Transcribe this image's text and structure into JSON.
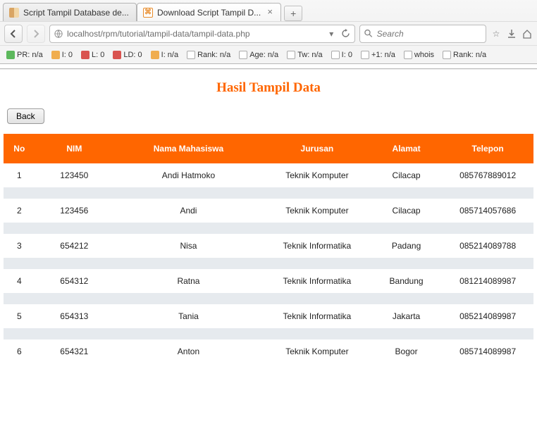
{
  "browser": {
    "tabs": [
      {
        "title": "Script Tampil Database de...",
        "active": false
      },
      {
        "title": "Download Script Tampil D...",
        "active": true
      }
    ],
    "url": "localhost/rpm/tutorial/tampil-data/tampil-data.php",
    "search_placeholder": "Search",
    "bookmarks": [
      {
        "label": "PR: n/a"
      },
      {
        "label": "I: 0"
      },
      {
        "label": "L: 0"
      },
      {
        "label": "LD: 0"
      },
      {
        "label": "I: n/a"
      },
      {
        "label": "Rank: n/a"
      },
      {
        "label": "Age: n/a"
      },
      {
        "label": "Tw: n/a"
      },
      {
        "label": "I: 0"
      },
      {
        "label": "+1: n/a"
      },
      {
        "label": "whois"
      },
      {
        "label": "Rank: n/a"
      }
    ]
  },
  "page": {
    "heading": "Hasil Tampil Data",
    "back_label": "Back",
    "columns": [
      "No",
      "NIM",
      "Nama Mahasiswa",
      "Jurusan",
      "Alamat",
      "Telepon"
    ],
    "rows": [
      {
        "no": "1",
        "nim": "123450",
        "nama": "Andi Hatmoko",
        "jurusan": "Teknik Komputer",
        "alamat": "Cilacap",
        "telepon": "085767889012"
      },
      {
        "no": "2",
        "nim": "123456",
        "nama": "Andi",
        "jurusan": "Teknik Komputer",
        "alamat": "Cilacap",
        "telepon": "085714057686"
      },
      {
        "no": "3",
        "nim": "654212",
        "nama": "Nisa",
        "jurusan": "Teknik Informatika",
        "alamat": "Padang",
        "telepon": "085214089788"
      },
      {
        "no": "4",
        "nim": "654312",
        "nama": "Ratna",
        "jurusan": "Teknik Informatika",
        "alamat": "Bandung",
        "telepon": "081214089987"
      },
      {
        "no": "5",
        "nim": "654313",
        "nama": "Tania",
        "jurusan": "Teknik Informatika",
        "alamat": "Jakarta",
        "telepon": "085214089987"
      },
      {
        "no": "6",
        "nim": "654321",
        "nama": "Anton",
        "jurusan": "Teknik Komputer",
        "alamat": "Bogor",
        "telepon": "085714089987"
      }
    ]
  }
}
